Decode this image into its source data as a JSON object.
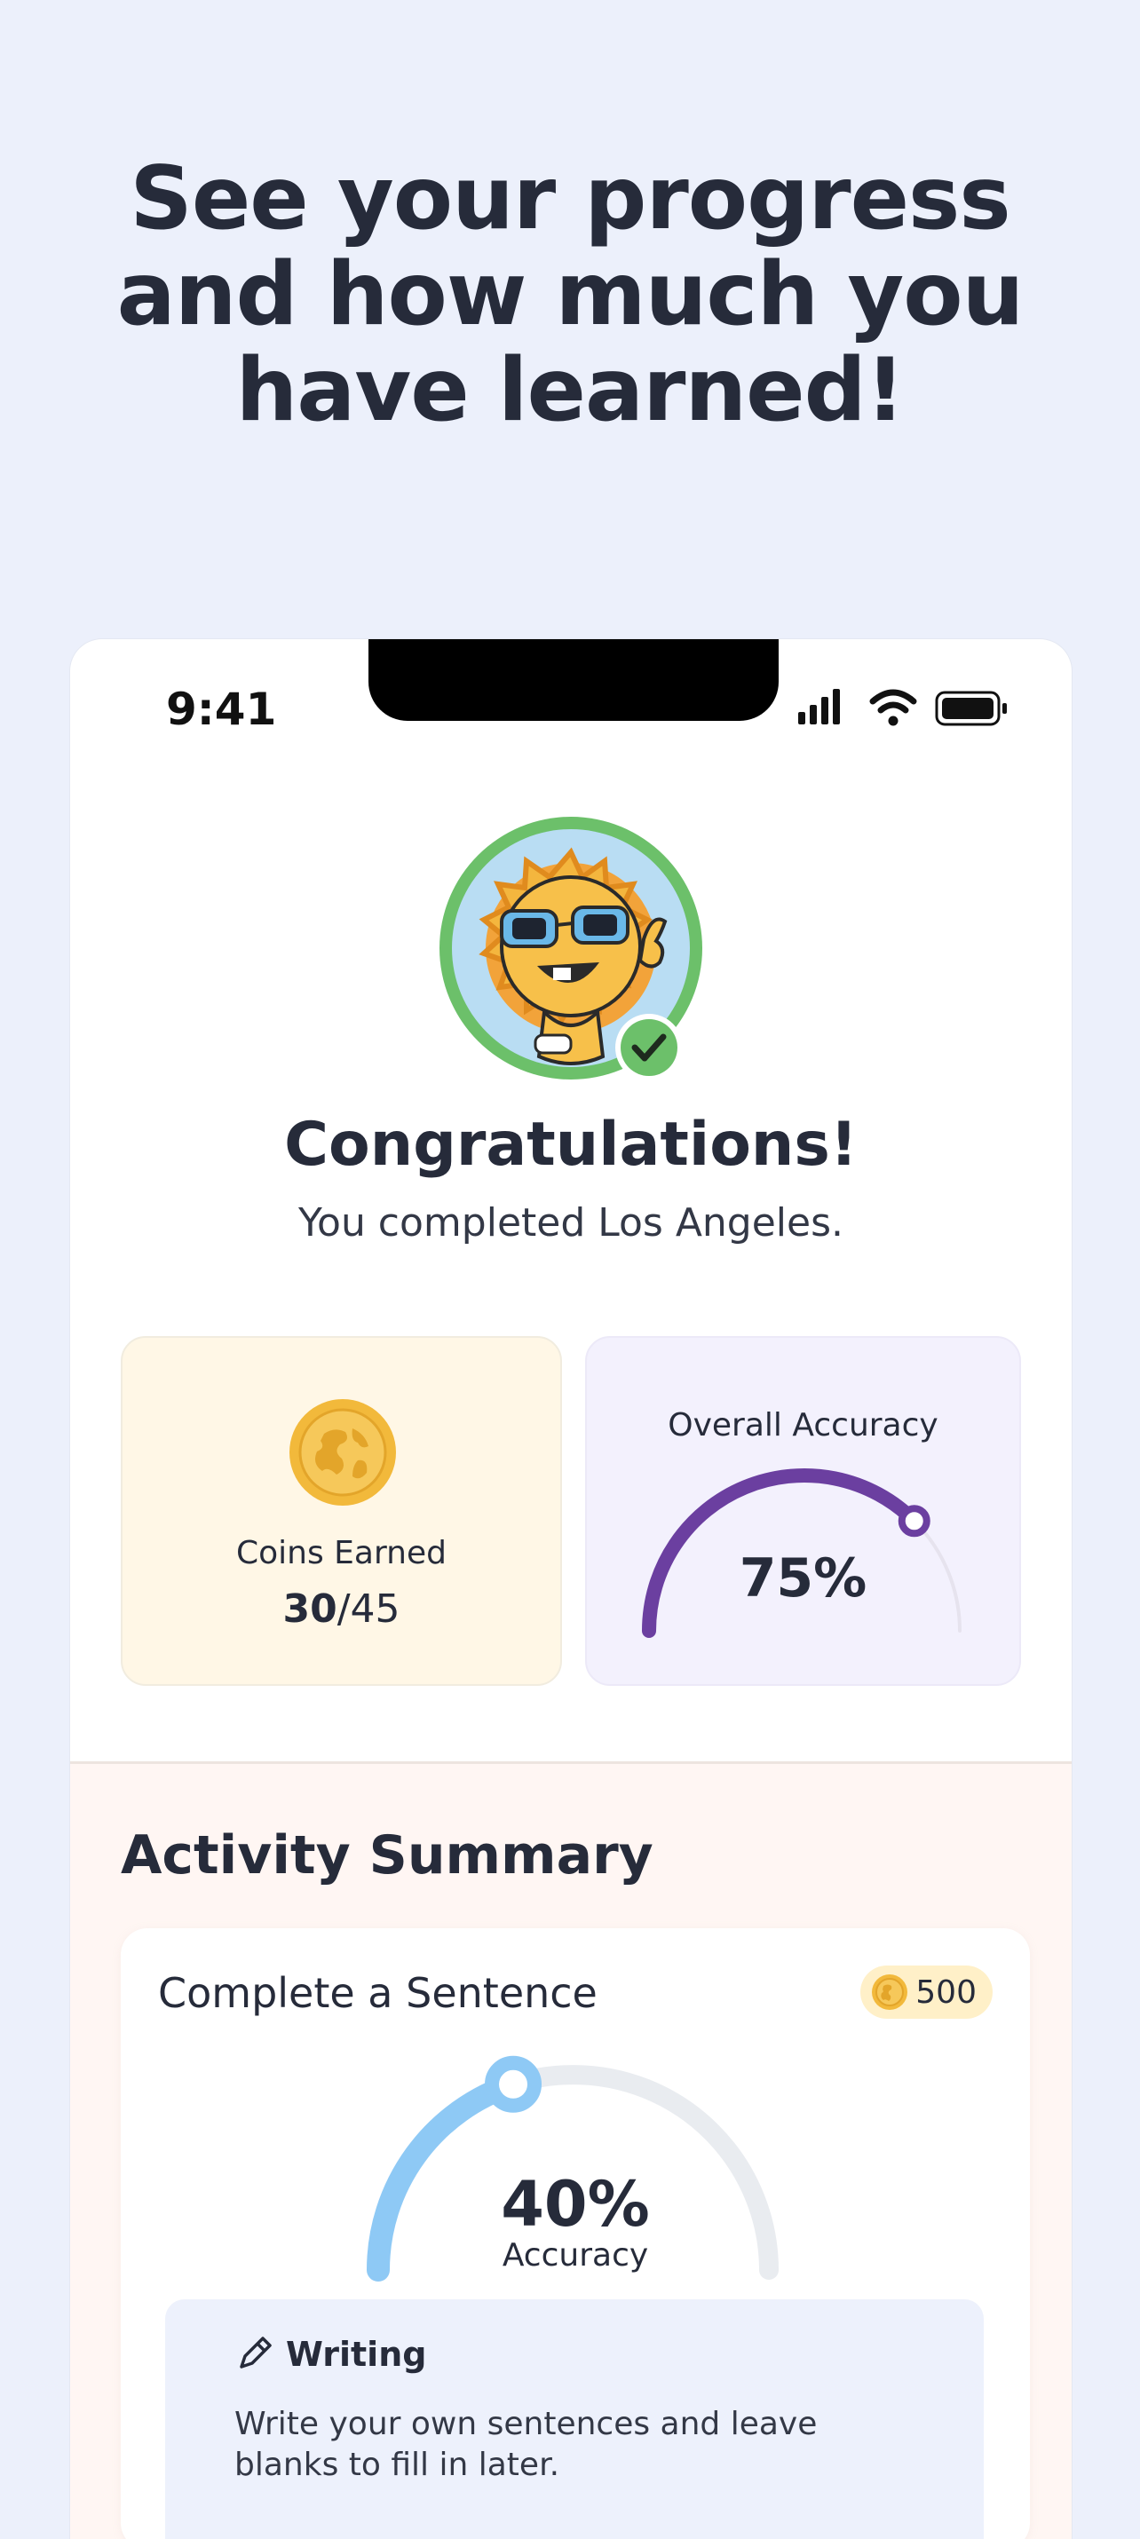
{
  "headline": [
    "See your progress",
    "and how much you",
    "have learned!"
  ],
  "status_bar": {
    "time": "9:41"
  },
  "completion": {
    "title": "Congratulations!",
    "subtitle": "You completed Los Angeles."
  },
  "coins": {
    "label": "Coins Earned",
    "earned": "30",
    "total": "/45"
  },
  "accuracy": {
    "label": "Overall Accuracy",
    "value": "75%",
    "fraction": 0.75
  },
  "summary": {
    "title": "Activity Summary",
    "activity": {
      "title": "Complete a Sentence",
      "coins": "500",
      "accuracy_value": "40%",
      "accuracy_fraction": 0.4,
      "accuracy_caption": "Accuracy",
      "section_title": "Writing",
      "section_desc": "Write your own sentences and leave blanks to fill in later."
    }
  },
  "colors": {
    "background": "#ECF0FB",
    "accent_purple": "#6B3FA0",
    "accent_blue": "#8EC9F5",
    "coin_gold": "#F2B93B",
    "avatar_ring": "#6CC06A"
  },
  "icons": [
    "signal-icon",
    "wifi-icon",
    "battery-icon",
    "checkmark-icon",
    "coin-icon",
    "pencil-icon"
  ]
}
